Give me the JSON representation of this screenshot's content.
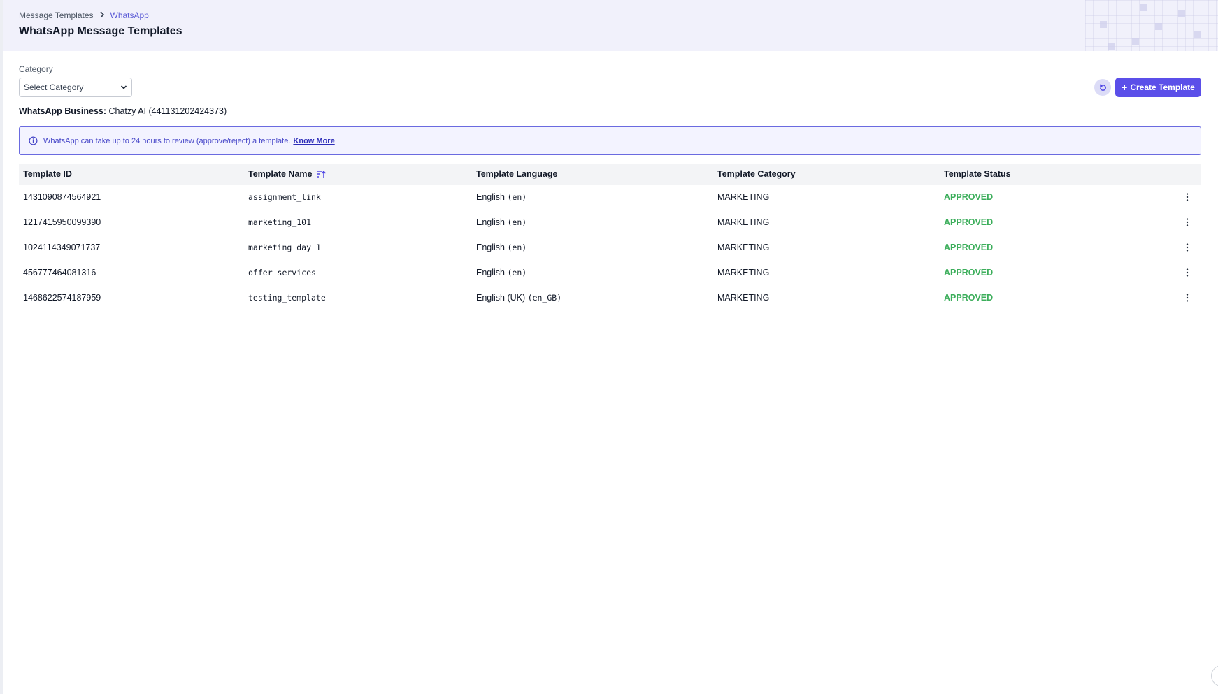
{
  "breadcrumb": {
    "root": "Message Templates",
    "current": "WhatsApp"
  },
  "page": {
    "title": "WhatsApp Message Templates"
  },
  "filters": {
    "category_label": "Category",
    "category_value": "Select Category"
  },
  "actions": {
    "create_label": "Create Template"
  },
  "business": {
    "label": "WhatsApp Business:",
    "value": "Chatzy AI (441131202424373)"
  },
  "notice": {
    "text": "WhatsApp can take up to 24 hours to review (approve/reject) a template.",
    "link": "Know More"
  },
  "table": {
    "headers": [
      "Template ID",
      "Template Name",
      "Template Language",
      "Template Category",
      "Template Status"
    ],
    "rows": [
      {
        "id": "1431090874564921",
        "name": "assignment_link",
        "lang_label": "English",
        "lang_code": "(en)",
        "category": "MARKETING",
        "status": "APPROVED"
      },
      {
        "id": "1217415950099390",
        "name": "marketing_101",
        "lang_label": "English",
        "lang_code": "(en)",
        "category": "MARKETING",
        "status": "APPROVED"
      },
      {
        "id": "1024114349071737",
        "name": "marketing_day_1",
        "lang_label": "English",
        "lang_code": "(en)",
        "category": "MARKETING",
        "status": "APPROVED"
      },
      {
        "id": "456777464081316",
        "name": "offer_services",
        "lang_label": "English",
        "lang_code": "(en)",
        "category": "MARKETING",
        "status": "APPROVED"
      },
      {
        "id": "1468622574187959",
        "name": "testing_template",
        "lang_label": "English (UK)",
        "lang_code": "(en_GB)",
        "category": "MARKETING",
        "status": "APPROVED"
      }
    ]
  },
  "colors": {
    "accent": "#5b4fe9",
    "approved": "#3cae5b",
    "header_bg": "#f1f1fb",
    "banner_border": "#6a6ae0"
  },
  "icons": {
    "breadcrumb_separator": "chevron-right-icon",
    "select": "chevron-down-icon",
    "refresh": "refresh-icon",
    "info": "info-icon",
    "sort": "sort-ascending-icon",
    "row_menu": "more-vertical-icon"
  }
}
